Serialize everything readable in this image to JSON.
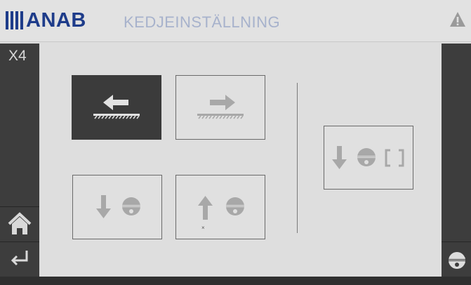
{
  "header": {
    "logo_text": "ANAB",
    "title": "KEDJEINSTÄLLNING",
    "warning_icon": "warning-icon"
  },
  "sidebar_left": {
    "station_label": "X4",
    "buttons": [
      {
        "name": "home-button",
        "icon": "home-icon"
      },
      {
        "name": "back-button",
        "icon": "return-icon"
      }
    ]
  },
  "sidebar_right": {
    "buttons": [
      {
        "name": "saw-button",
        "icon": "saw-blade-icon"
      }
    ]
  },
  "main": {
    "buttons": [
      {
        "name": "move-left-button",
        "icon": "arrow-left-rail-icon",
        "active": true
      },
      {
        "name": "move-right-button",
        "icon": "arrow-right-rail-icon",
        "active": false
      },
      {
        "name": "lower-saw-button",
        "icon": "arrow-down-saw-icon",
        "active": false
      },
      {
        "name": "raise-saw-button",
        "icon": "arrow-up-saw-icon",
        "active": false
      },
      {
        "name": "lower-saw-bracket-button",
        "icon": "arrow-down-saw-bracket-icon",
        "active": false
      }
    ],
    "small_mark": "×"
  },
  "colors": {
    "logo": "#1e3c8a",
    "title": "#a7b2cc",
    "active_button": "#3b3b3b",
    "disabled_icon": "#a8a8a8",
    "sidebar": "#3d3d3d"
  }
}
